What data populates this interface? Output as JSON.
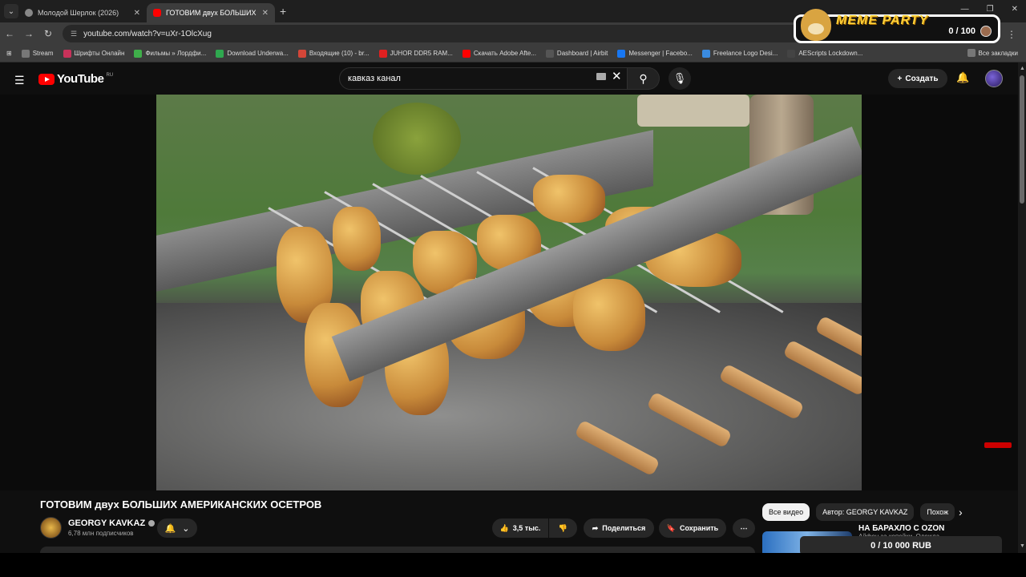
{
  "browser": {
    "tabs": [
      {
        "title": "Молодой Шерлок (2026)",
        "active": false
      },
      {
        "title": "ГОТОВИМ двух БОЛЬШИХ",
        "active": true
      }
    ],
    "url": "youtube.com/watch?v=uXr-1OlcXug",
    "bookmarks": [
      "Stream",
      "Шрифты Онлайн",
      "Фильмы » Лордфи...",
      "Download Underwa...",
      "Входящие (10) - br...",
      "JUHOR DDR5 RAM...",
      "Скачать Adobe Afte...",
      "Dashboard | Airbit",
      "Messenger | Facebo...",
      "Freelance Logo Desi...",
      "AEScripts Lockdown..."
    ],
    "all_bookmarks": "Все закладки"
  },
  "overlay": {
    "meme_title": "MEME PARTY",
    "meme_count": "0 / 100",
    "donation": "0 / 10 000 RUB"
  },
  "youtube": {
    "logo": "YouTube",
    "region": "RU",
    "search_query": "кавказ канал",
    "create_label": "Создать"
  },
  "video": {
    "title": "ГОТОВИМ двух БОЛЬШИХ АМЕРИКАНСКИХ ОСЕТРОВ",
    "channel": "GEORGY KAVKAZ",
    "subscribers": "6,78 млн подписчиков",
    "likes": "3,5 тыс.",
    "share_label": "Поделиться",
    "save_label": "Сохранить"
  },
  "sidebar": {
    "chips": [
      "Все видео",
      "Автор: GEORGY KAVKAZ",
      "Похож"
    ],
    "rec_title": "НА БАРАХЛО С OZON",
    "rec_sub": "Айфон за копейки. Одежда..."
  },
  "icons": {
    "hamburger": "menu-icon",
    "search": "search-icon",
    "mic": "mic-icon",
    "bell": "bell-icon",
    "like": "thumb-up-icon",
    "dislike": "thumb-down-icon",
    "share": "share-icon",
    "save": "save-icon",
    "more": "more-icon"
  },
  "colors": {
    "yt_red": "#ff0000",
    "meme_yellow": "#ffd23a",
    "background": "#0f0f0f"
  }
}
